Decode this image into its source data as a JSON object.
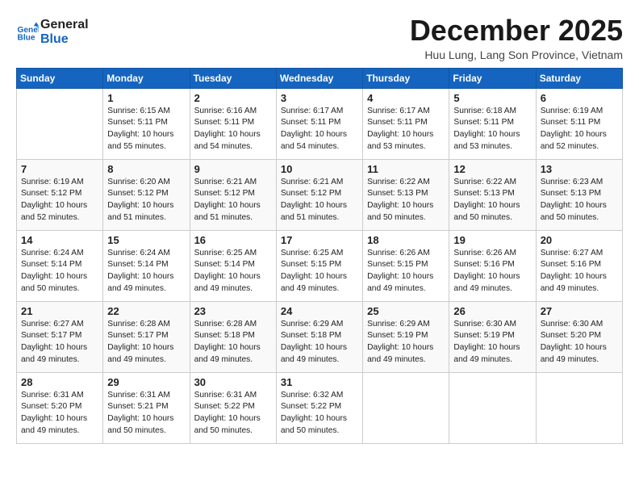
{
  "logo": {
    "line1": "General",
    "line2": "Blue"
  },
  "title": "December 2025",
  "subtitle": "Huu Lung, Lang Son Province, Vietnam",
  "weekdays": [
    "Sunday",
    "Monday",
    "Tuesday",
    "Wednesday",
    "Thursday",
    "Friday",
    "Saturday"
  ],
  "weeks": [
    [
      {
        "day": "",
        "info": ""
      },
      {
        "day": "1",
        "info": "Sunrise: 6:15 AM\nSunset: 5:11 PM\nDaylight: 10 hours\nand 55 minutes."
      },
      {
        "day": "2",
        "info": "Sunrise: 6:16 AM\nSunset: 5:11 PM\nDaylight: 10 hours\nand 54 minutes."
      },
      {
        "day": "3",
        "info": "Sunrise: 6:17 AM\nSunset: 5:11 PM\nDaylight: 10 hours\nand 54 minutes."
      },
      {
        "day": "4",
        "info": "Sunrise: 6:17 AM\nSunset: 5:11 PM\nDaylight: 10 hours\nand 53 minutes."
      },
      {
        "day": "5",
        "info": "Sunrise: 6:18 AM\nSunset: 5:11 PM\nDaylight: 10 hours\nand 53 minutes."
      },
      {
        "day": "6",
        "info": "Sunrise: 6:19 AM\nSunset: 5:11 PM\nDaylight: 10 hours\nand 52 minutes."
      }
    ],
    [
      {
        "day": "7",
        "info": "Sunrise: 6:19 AM\nSunset: 5:12 PM\nDaylight: 10 hours\nand 52 minutes."
      },
      {
        "day": "8",
        "info": "Sunrise: 6:20 AM\nSunset: 5:12 PM\nDaylight: 10 hours\nand 51 minutes."
      },
      {
        "day": "9",
        "info": "Sunrise: 6:21 AM\nSunset: 5:12 PM\nDaylight: 10 hours\nand 51 minutes."
      },
      {
        "day": "10",
        "info": "Sunrise: 6:21 AM\nSunset: 5:12 PM\nDaylight: 10 hours\nand 51 minutes."
      },
      {
        "day": "11",
        "info": "Sunrise: 6:22 AM\nSunset: 5:13 PM\nDaylight: 10 hours\nand 50 minutes."
      },
      {
        "day": "12",
        "info": "Sunrise: 6:22 AM\nSunset: 5:13 PM\nDaylight: 10 hours\nand 50 minutes."
      },
      {
        "day": "13",
        "info": "Sunrise: 6:23 AM\nSunset: 5:13 PM\nDaylight: 10 hours\nand 50 minutes."
      }
    ],
    [
      {
        "day": "14",
        "info": "Sunrise: 6:24 AM\nSunset: 5:14 PM\nDaylight: 10 hours\nand 50 minutes."
      },
      {
        "day": "15",
        "info": "Sunrise: 6:24 AM\nSunset: 5:14 PM\nDaylight: 10 hours\nand 49 minutes."
      },
      {
        "day": "16",
        "info": "Sunrise: 6:25 AM\nSunset: 5:14 PM\nDaylight: 10 hours\nand 49 minutes."
      },
      {
        "day": "17",
        "info": "Sunrise: 6:25 AM\nSunset: 5:15 PM\nDaylight: 10 hours\nand 49 minutes."
      },
      {
        "day": "18",
        "info": "Sunrise: 6:26 AM\nSunset: 5:15 PM\nDaylight: 10 hours\nand 49 minutes."
      },
      {
        "day": "19",
        "info": "Sunrise: 6:26 AM\nSunset: 5:16 PM\nDaylight: 10 hours\nand 49 minutes."
      },
      {
        "day": "20",
        "info": "Sunrise: 6:27 AM\nSunset: 5:16 PM\nDaylight: 10 hours\nand 49 minutes."
      }
    ],
    [
      {
        "day": "21",
        "info": "Sunrise: 6:27 AM\nSunset: 5:17 PM\nDaylight: 10 hours\nand 49 minutes."
      },
      {
        "day": "22",
        "info": "Sunrise: 6:28 AM\nSunset: 5:17 PM\nDaylight: 10 hours\nand 49 minutes."
      },
      {
        "day": "23",
        "info": "Sunrise: 6:28 AM\nSunset: 5:18 PM\nDaylight: 10 hours\nand 49 minutes."
      },
      {
        "day": "24",
        "info": "Sunrise: 6:29 AM\nSunset: 5:18 PM\nDaylight: 10 hours\nand 49 minutes."
      },
      {
        "day": "25",
        "info": "Sunrise: 6:29 AM\nSunset: 5:19 PM\nDaylight: 10 hours\nand 49 minutes."
      },
      {
        "day": "26",
        "info": "Sunrise: 6:30 AM\nSunset: 5:19 PM\nDaylight: 10 hours\nand 49 minutes."
      },
      {
        "day": "27",
        "info": "Sunrise: 6:30 AM\nSunset: 5:20 PM\nDaylight: 10 hours\nand 49 minutes."
      }
    ],
    [
      {
        "day": "28",
        "info": "Sunrise: 6:31 AM\nSunset: 5:20 PM\nDaylight: 10 hours\nand 49 minutes."
      },
      {
        "day": "29",
        "info": "Sunrise: 6:31 AM\nSunset: 5:21 PM\nDaylight: 10 hours\nand 50 minutes."
      },
      {
        "day": "30",
        "info": "Sunrise: 6:31 AM\nSunset: 5:22 PM\nDaylight: 10 hours\nand 50 minutes."
      },
      {
        "day": "31",
        "info": "Sunrise: 6:32 AM\nSunset: 5:22 PM\nDaylight: 10 hours\nand 50 minutes."
      },
      {
        "day": "",
        "info": ""
      },
      {
        "day": "",
        "info": ""
      },
      {
        "day": "",
        "info": ""
      }
    ]
  ]
}
